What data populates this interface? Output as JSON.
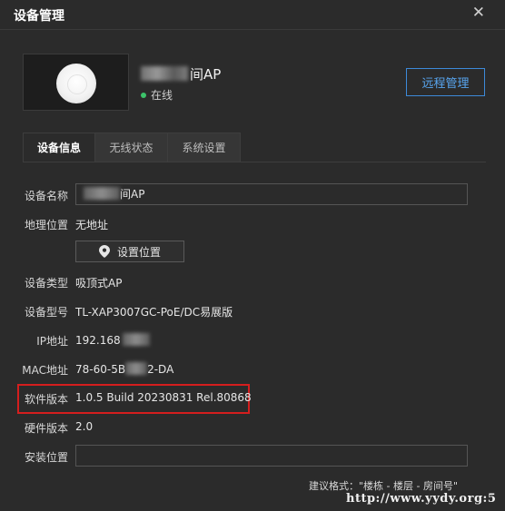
{
  "dialog": {
    "title": "设备管理",
    "close_symbol": "✕"
  },
  "device": {
    "name_visible": "间AP",
    "status": "在线",
    "remote_button": "远程管理"
  },
  "tabs": [
    {
      "label": "设备信息",
      "active": true
    },
    {
      "label": "无线状态",
      "active": false
    },
    {
      "label": "系统设置",
      "active": false
    }
  ],
  "fields": {
    "device_name_label": "设备名称",
    "device_name_value": "间AP",
    "location_label": "地理位置",
    "location_value": "无地址",
    "set_location_button": "设置位置",
    "type_label": "设备类型",
    "type_value": "吸顶式AP",
    "model_label": "设备型号",
    "model_value": "TL-XAP3007GC-PoE/DC易展版",
    "ip_label": "IP地址",
    "ip_value_prefix": "192.168",
    "mac_label": "MAC地址",
    "mac_value_prefix": "78-60-5B",
    "mac_value_suffix": "2-DA",
    "software_label": "软件版本",
    "software_value": "1.0.5 Build 20230831 Rel.80868",
    "hardware_label": "硬件版本",
    "hardware_value": "2.0",
    "install_label": "安装位置",
    "install_value": "",
    "install_hint": "建议格式：\"楼栋 - 楼层 - 房间号\""
  },
  "watermark": "http://www.yydy.org:5",
  "colors": {
    "background": "#2b2b2b",
    "accent_blue": "#3d8ad9",
    "online_green": "#3cc36a",
    "highlight_red": "#d41e1e"
  },
  "icons": {
    "close": "close-icon",
    "status": "status-dot-icon",
    "location": "location-pin-icon"
  }
}
